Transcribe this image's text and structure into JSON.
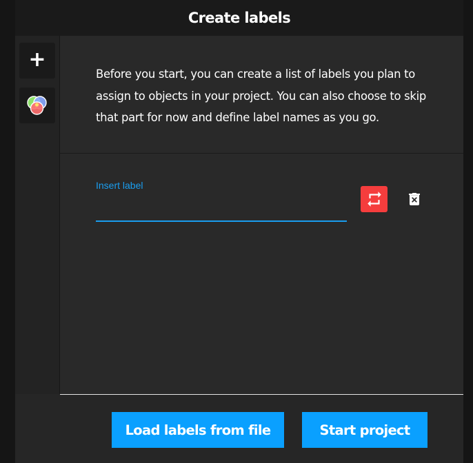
{
  "popup": {
    "title": "Create labels"
  },
  "sidebar": {
    "add_icon": "plus-icon",
    "color_icon": "color-palette-icon"
  },
  "description": "Before you start, you can create a list of labels you plan to assign to objects in your project. You can also choose to skip that part for now and define label names as you go.",
  "label_field": {
    "label": "Insert label",
    "value": "",
    "placeholder": ""
  },
  "actions": {
    "repeat_icon": "repeat-icon",
    "delete_icon": "trash-icon"
  },
  "footer": {
    "load_button": "Load labels from file",
    "start_button": "Start project"
  },
  "colors": {
    "accent": "#0aa0ff",
    "danger": "#f53d3d",
    "header_bg": "#1a1a1a",
    "panel_bg": "#292929"
  }
}
